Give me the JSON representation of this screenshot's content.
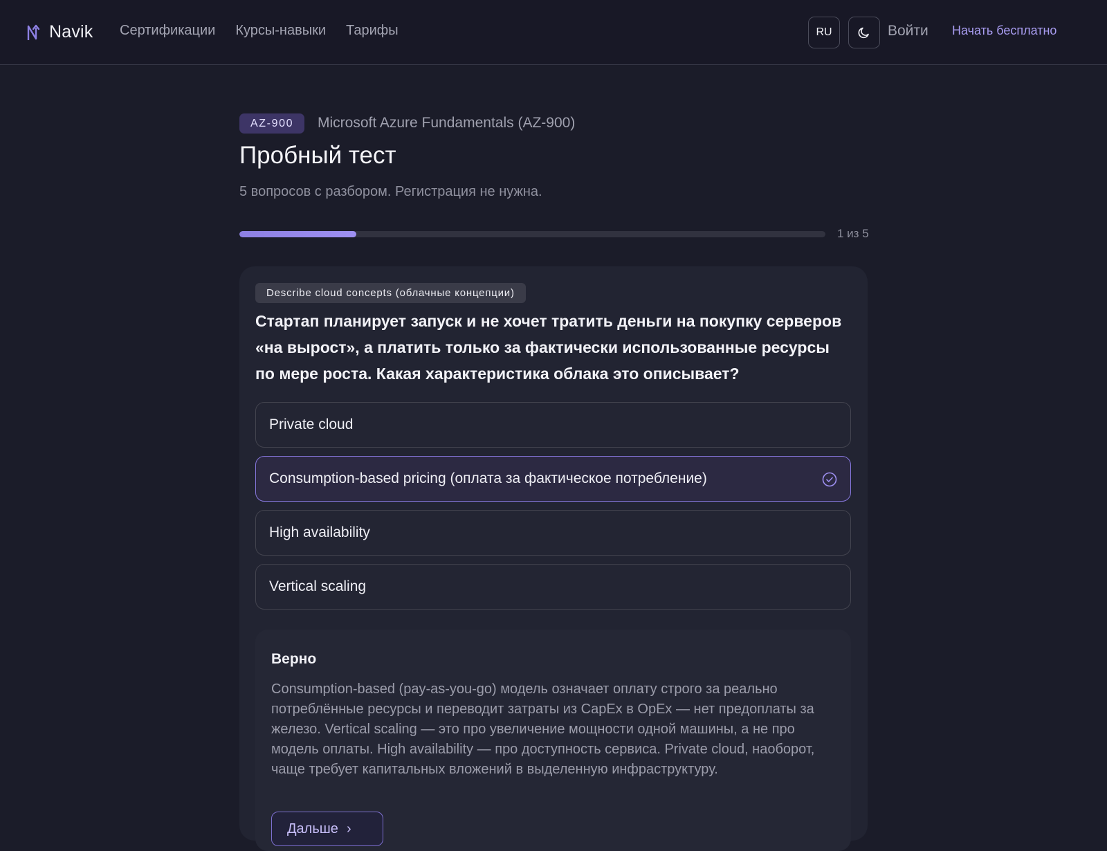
{
  "header": {
    "brand": "Navik",
    "nav": [
      {
        "label": "Сертификации"
      },
      {
        "label": "Курсы-навыки"
      },
      {
        "label": "Тарифы"
      }
    ],
    "lang_label": "RU",
    "login_label": "Войти",
    "cta_label": "Начать бесплатно"
  },
  "exam": {
    "code": "AZ-900",
    "name": "Microsoft Azure Fundamentals (AZ-900)"
  },
  "page": {
    "title": "Пробный тест",
    "subtitle": "5 вопросов с разбором. Регистрация не нужна."
  },
  "progress": {
    "current": 1,
    "total": 5,
    "fraction": 0.2,
    "label": "1 из 5"
  },
  "question": {
    "topic": "Describe cloud concepts (облачные концепции)",
    "text": "Стартап планирует запуск и не хочет тратить деньги на покупку серверов «на вырост», а платить только за фактически использованные ресурсы по мере роста. Какая характеристика облака это описывает?",
    "options": [
      {
        "label": "Private cloud"
      },
      {
        "label": "Consumption-based pricing (оплата за фактическое потребление)"
      },
      {
        "label": "High availability"
      },
      {
        "label": "Vertical scaling"
      }
    ],
    "selected_index": 1
  },
  "feedback": {
    "title": "Верно",
    "text": "Consumption-based (pay-as-you-go) модель означает оплату строго за реально потреблённые ресурсы и переводит затраты из CapEx в OpEx — нет предоплаты за железо. Vertical scaling — это про увеличение мощности одной машины, а не про модель оплаты. High availability — про доступность сервиса. Private cloud, наоборот, чаще требует капитальных вложений в выделенную инфраструктуру.",
    "next_label": "Дальше"
  },
  "colors": {
    "background": "#1b1c29",
    "accent": "#9e90f2",
    "card": "#222432"
  }
}
